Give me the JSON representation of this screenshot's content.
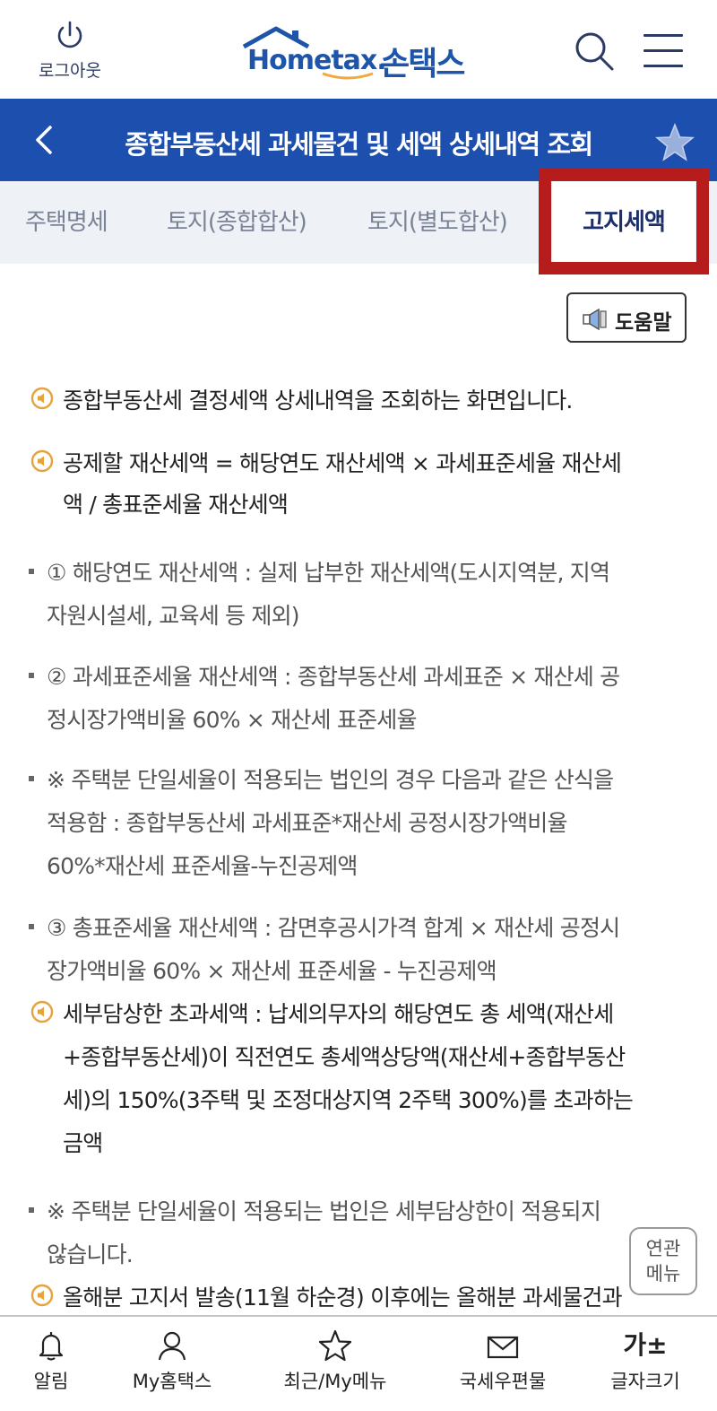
{
  "header": {
    "logout_label": "로그아웃",
    "logo_text": "Hometax.",
    "logo_kr": "손택스"
  },
  "titlebar": {
    "title": "종합부동산세 과세물건 및 세액 상세내역 조회"
  },
  "tabs": [
    {
      "label": "주택명세",
      "active": false
    },
    {
      "label": "토지(종합합산)",
      "active": false
    },
    {
      "label": "토지(별도합산)",
      "active": false
    },
    {
      "label": "고지세액",
      "active": true
    }
  ],
  "help_button": "도움말",
  "notes": [
    {
      "type": "main",
      "lines": [
        "종합부동산세 결정세액 상세내역을 조회하는 화면입니다."
      ]
    },
    {
      "type": "main",
      "lines": [
        "공제할 재산세액 = 해당연도 재산세액 × 과세표준세율 재산세",
        "액 / 총표준세율 재산세액"
      ]
    },
    {
      "type": "sub",
      "lines": [
        "① 해당연도 재산세액 : 실제 납부한 재산세액(도시지역분, 지역",
        "자원시설세, 교육세 등 제외)"
      ]
    },
    {
      "type": "sub",
      "lines": [
        "② 과세표준세율 재산세액 : 종합부동산세 과세표준 × 재산세 공",
        "정시장가액비율 60% × 재산세 표준세율"
      ]
    },
    {
      "type": "sub",
      "lines": [
        "※ 주택분 단일세율이 적용되는 법인의 경우 다음과 같은 산식을",
        "적용함 : 종합부동산세 과세표준*재산세 공정시장가액비율",
        "60%*재산세 표준세율-누진공제액"
      ]
    },
    {
      "type": "sub",
      "lines": [
        "③ 총표준세율 재산세액 : 감면후공시가격 합계 × 재산세 공정시",
        "장가액비율 60% × 재산세 표준세율 - 누진공제액"
      ]
    },
    {
      "type": "main",
      "lines": [
        "세부담상한 초과세액 : 납세의무자의 해당연도 총 세액(재산세",
        "+종합부동산세)이 직전연도 총세액상당액(재산세+종합부동산",
        "세)의 150%(3주택 및 조정대상지역 2주택 300%)를 초과하는",
        "금액"
      ]
    },
    {
      "type": "sub",
      "lines": [
        "※ 주택분 단일세율이 적용되는 법인은 세부담상한이 적용되지",
        "않습니다."
      ]
    },
    {
      "type": "main",
      "lines": [
        "올해분 고지서 발송(11월 하순경) 이후에는 올해분 과세물건과"
      ]
    }
  ],
  "related_menu": [
    "연관",
    "메뉴"
  ],
  "bottom_nav": [
    {
      "label": "알림",
      "icon": "bell-icon"
    },
    {
      "label": "My홈택스",
      "icon": "person-icon"
    },
    {
      "label": "최근/My메뉴",
      "icon": "star-icon"
    },
    {
      "label": "국세우편물",
      "icon": "mail-icon"
    },
    {
      "label": "글자크기",
      "icon": "font-size-icon",
      "glyph": "가±"
    }
  ]
}
